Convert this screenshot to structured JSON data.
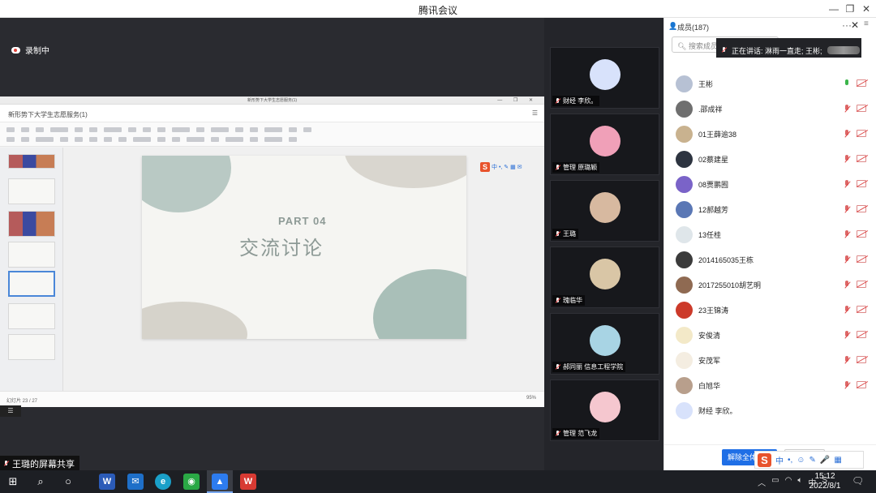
{
  "window": {
    "title": "腾讯会议",
    "min": "—",
    "restore": "❐",
    "close": "✕"
  },
  "recording": {
    "label": "录制中"
  },
  "share": {
    "app_title": "新形势下大学生志愿服务(1)",
    "doc_name": "新形势下大学生志愿服务(1)",
    "slide": {
      "part": "PART  04",
      "title": "交流讨论"
    },
    "status_left": "幻灯片 23 / 27",
    "zoom": "95%",
    "sharer_label": "王璐的屏幕共享"
  },
  "tiles": [
    {
      "name": "财经 李欣。",
      "color": "#d8e2fb"
    },
    {
      "name": "管理 原璐颖",
      "color": "#f0a0b8"
    },
    {
      "name": "王璐",
      "color": "#d7b9a0"
    },
    {
      "name": "瑰临华",
      "color": "#d9c6a6"
    },
    {
      "name": "郝同丽 信息工程学院",
      "color": "#a8d4e4"
    },
    {
      "name": "管理 范飞龙",
      "color": "#f5c7cf"
    }
  ],
  "members": {
    "header": "成员(187)",
    "search_placeholder": "搜索成员",
    "speaking": "正在讲话: 淋雨一直走; 王彬;",
    "list": [
      {
        "name": "王彬",
        "mic_on": true,
        "color": "#b7c1d4"
      },
      {
        "name": ".邵成祥",
        "mic_on": false,
        "color": "#6f6f6f"
      },
      {
        "name": "01王薛逾38",
        "mic_on": false,
        "color": "#c9b28f"
      },
      {
        "name": "02蔡建星",
        "mic_on": false,
        "color": "#2d3440"
      },
      {
        "name": "08贾鹏囿",
        "mic_on": false,
        "color": "#7a63c8"
      },
      {
        "name": "12郝越芳",
        "mic_on": false,
        "color": "#5a77b5"
      },
      {
        "name": "13任桂",
        "mic_on": false,
        "color": "#dfe6ea"
      },
      {
        "name": "2014165035王栋",
        "mic_on": false,
        "color": "#3b3b3b"
      },
      {
        "name": "2017255010胡艺明",
        "mic_on": false,
        "color": "#8f6a52"
      },
      {
        "name": "23王锦涛",
        "mic_on": false,
        "color": "#cc3a2a"
      },
      {
        "name": "安俊清",
        "mic_on": false,
        "color": "#f3e9c8"
      },
      {
        "name": "安茂军",
        "mic_on": false,
        "color": "#f4ede1"
      },
      {
        "name": "白旭华",
        "mic_on": false,
        "color": "#b89f8c"
      },
      {
        "name": "财经 李欣。",
        "mic_on": false,
        "color": "#d8e2fb"
      }
    ],
    "unmute_all": "解除全体静音"
  },
  "ime": {
    "logo": "S",
    "items": [
      "中",
      "•,",
      "☺",
      "✎",
      "🎤",
      "▦"
    ]
  },
  "taskbar": {
    "time": "15:12",
    "date": "2022/8/1",
    "tray_lang": "中"
  }
}
